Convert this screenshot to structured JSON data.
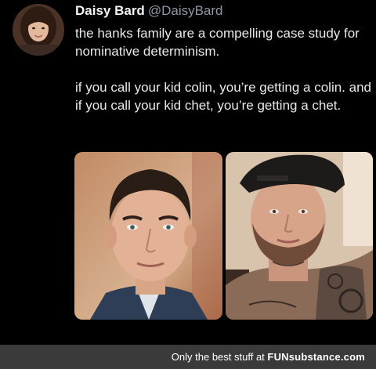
{
  "tweet": {
    "display_name": "Daisy Bard",
    "handle": "@DaisyBard",
    "paragraphs": [
      "the hanks family are a compelling case study for nominative determinism.",
      "if you call your kid colin, you’re getting a colin. and if you call your kid chet, you’re getting a chet."
    ],
    "images": [
      {
        "icon": "portrait-photo-colin",
        "background": "#c9a07e"
      },
      {
        "icon": "portrait-photo-chet",
        "background": "#d8c3ad"
      }
    ]
  },
  "footer": {
    "tagline": "Only the best stuff at",
    "brand_fun": "FUN",
    "brand_rest": "substance.com"
  },
  "colors": {
    "background": "#000000",
    "text": "#e7e9ea",
    "handle": "#8b98a5",
    "footer_bg": "#3a3a3a"
  }
}
